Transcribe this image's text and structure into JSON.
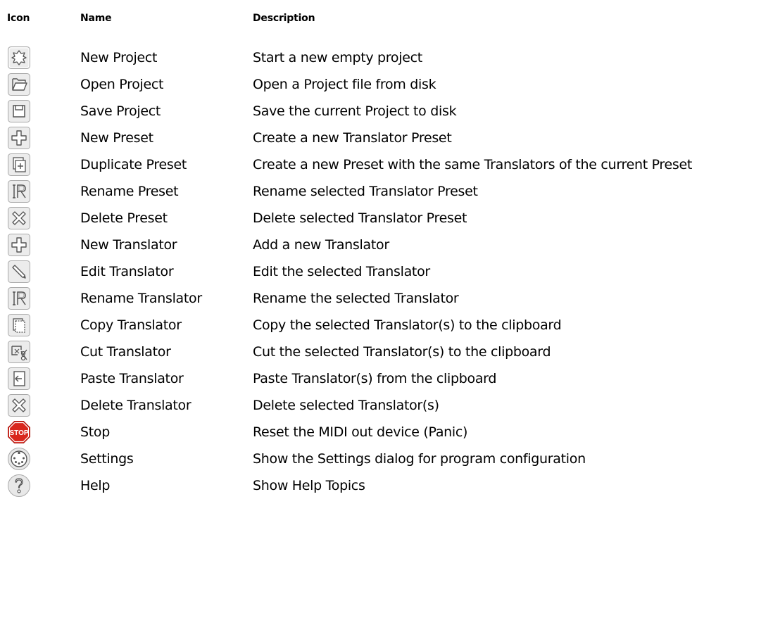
{
  "headers": {
    "icon": "Icon",
    "name": "Name",
    "description": "Description"
  },
  "rows": [
    {
      "icon": "new-project-icon",
      "name": "New Project",
      "description": "Start a new empty project"
    },
    {
      "icon": "open-folder-icon",
      "name": "Open Project",
      "description": "Open a Project file from disk"
    },
    {
      "icon": "save-disk-icon",
      "name": "Save Project",
      "description": "Save the current Project to disk"
    },
    {
      "icon": "plus-icon",
      "name": "New Preset",
      "description": "Create a new Translator Preset"
    },
    {
      "icon": "duplicate-icon",
      "name": "Duplicate Preset",
      "description": "Create a new Preset with the same Translators of the current Preset"
    },
    {
      "icon": "rename-icon",
      "name": "Rename Preset",
      "description": "Rename selected Translator Preset"
    },
    {
      "icon": "delete-x-icon",
      "name": "Delete Preset",
      "description": "Delete selected Translator Preset"
    },
    {
      "icon": "plus-icon",
      "name": "New Translator",
      "description": "Add a new Translator"
    },
    {
      "icon": "pencil-icon",
      "name": "Edit Translator",
      "description": "Edit the selected Translator"
    },
    {
      "icon": "rename-icon",
      "name": "Rename Translator",
      "description": "Rename the selected Translator"
    },
    {
      "icon": "copy-icon",
      "name": "Copy Translator",
      "description": "Copy the selected Translator(s) to the clipboard"
    },
    {
      "icon": "cut-scissors-icon",
      "name": "Cut Translator",
      "description": "Cut the selected Translator(s) to the clipboard"
    },
    {
      "icon": "paste-icon",
      "name": "Paste Translator",
      "description": "Paste Translator(s) from the clipboard"
    },
    {
      "icon": "delete-x-icon",
      "name": "Delete Translator",
      "description": "Delete selected Translator(s)"
    },
    {
      "icon": "stop-sign-icon",
      "icon_text": "STOP",
      "name": "Stop",
      "description": "Reset the MIDI out device (Panic)"
    },
    {
      "icon": "midi-connector-icon",
      "name": "Settings",
      "description": "Show the Settings dialog for program configuration"
    },
    {
      "icon": "help-question-icon",
      "name": "Help",
      "description": "Show Help Topics"
    }
  ],
  "colors": {
    "button_face": "#ececec",
    "button_border": "#a9a9a9",
    "glyph": "#555555",
    "stop_red": "#d9261c"
  }
}
